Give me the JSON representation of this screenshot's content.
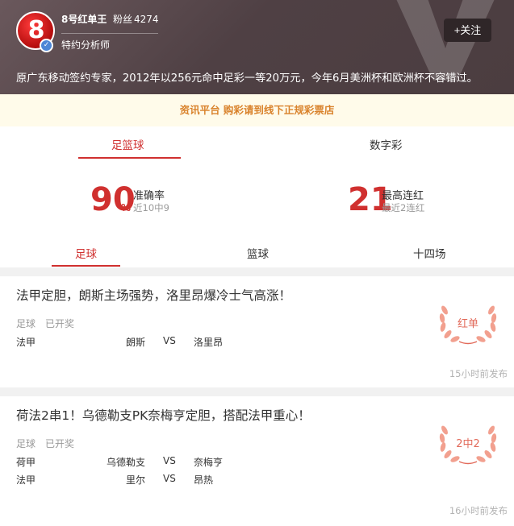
{
  "profile": {
    "avatar_text": "8",
    "name": "8号红单王",
    "fans_label": "粉丝",
    "fans_count": "4274",
    "role": "特约分析师",
    "follow_label": "+关注",
    "intro": "原广东移动签约专家，2012年以256元命中足彩一等20万元，今年6月美洲杯和欧洲杯不容错过。"
  },
  "notice": "资讯平台 购彩请到线下正规彩票店",
  "tabs": [
    {
      "label": "足篮球",
      "active": true
    },
    {
      "label": "数字彩",
      "active": false
    }
  ],
  "stats": {
    "accuracy": {
      "value": "90",
      "unit": "%",
      "label": "准确率",
      "sub": "近10中9"
    },
    "streak": {
      "value": "21",
      "label": "最高连红",
      "sub": "最近2连红"
    }
  },
  "subtabs": [
    {
      "label": "足球",
      "active": true
    },
    {
      "label": "篮球",
      "active": false
    },
    {
      "label": "十四场",
      "active": false
    }
  ],
  "cards": [
    {
      "title": "法甲定胆，朗斯主场强势，洛里昂爆冷士气高涨！",
      "sport": "足球",
      "status": "已开奖",
      "matches": [
        {
          "league": "法甲",
          "home": "朗斯",
          "vs": "VS",
          "away": "洛里昂"
        }
      ],
      "badge": "红单",
      "time": "15小时前发布"
    },
    {
      "title": "荷法2串1！乌德勒支PK奈梅亨定胆，搭配法甲重心！",
      "sport": "足球",
      "status": "已开奖",
      "matches": [
        {
          "league": "荷甲",
          "home": "乌德勒支",
          "vs": "VS",
          "away": "奈梅亨"
        },
        {
          "league": "法甲",
          "home": "里尔",
          "vs": "VS",
          "away": "昂热"
        }
      ],
      "badge": "2中2",
      "time": "16小时前发布"
    }
  ],
  "colors": {
    "accent": "#d0302f",
    "notice_text": "#d9822b",
    "badge": "#e26a5a"
  }
}
